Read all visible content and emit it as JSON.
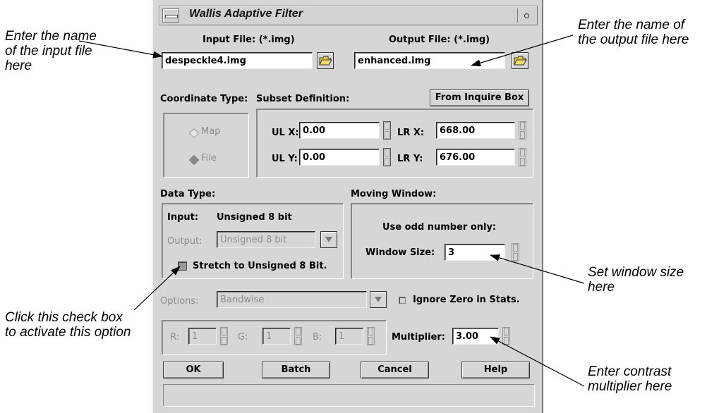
{
  "window": {
    "title": "Wallis Adaptive Filter",
    "input_file_label": "Input File: (*.img)",
    "input_file_value": "despeckle4.img",
    "output_file_label": "Output File: (*.img)",
    "output_file_value": "enhanced.img",
    "coordinate_type_label": "Coordinate Type:",
    "subset_definition_label": "Subset Definition:",
    "from_inquire_box_button": "From Inquire Box",
    "coordinate_options": [
      "Map",
      "File"
    ],
    "ulx_label": "UL X:",
    "ulx_value": "0.00",
    "uly_label": "UL Y:",
    "uly_value": "0.00",
    "lrx_label": "LR X:",
    "lrx_value": "668.00",
    "lry_label": "LR Y:",
    "lry_value": "676.00",
    "data_type_label": "Data Type:",
    "input_label": "Input:",
    "input_type_value": "Unsigned 8 bit",
    "output_label": "Output:",
    "output_type_value": "Unsigned 8 bit",
    "stretch_label": "Stretch to Unsigned 8 Bit.",
    "moving_window_label": "Moving Window:",
    "odd_number_label": "Use odd number only:",
    "window_size_label": "Window Size:",
    "window_size_value": "3",
    "options_label": "Options:",
    "options_value": "Bandwise",
    "ignore_zero_label": "Ignore Zero in Stats.",
    "r_label": "R:",
    "r_value": "1",
    "g_label": "G:",
    "g_value": "1",
    "b_label": "B:",
    "b_value": "1",
    "multiplier_label": "Multiplier:",
    "multiplier_value": "3.00",
    "buttons": [
      "OK",
      "Batch",
      "Cancel",
      "Help"
    ]
  },
  "callouts": {
    "input_file": "Enter the name of the input file here",
    "output_file": "Enter the name of the output file here",
    "window_size": "Set window size here",
    "check_box": "Click this check box to activate this option",
    "multiplier": "Enter contrast multiplier here"
  }
}
